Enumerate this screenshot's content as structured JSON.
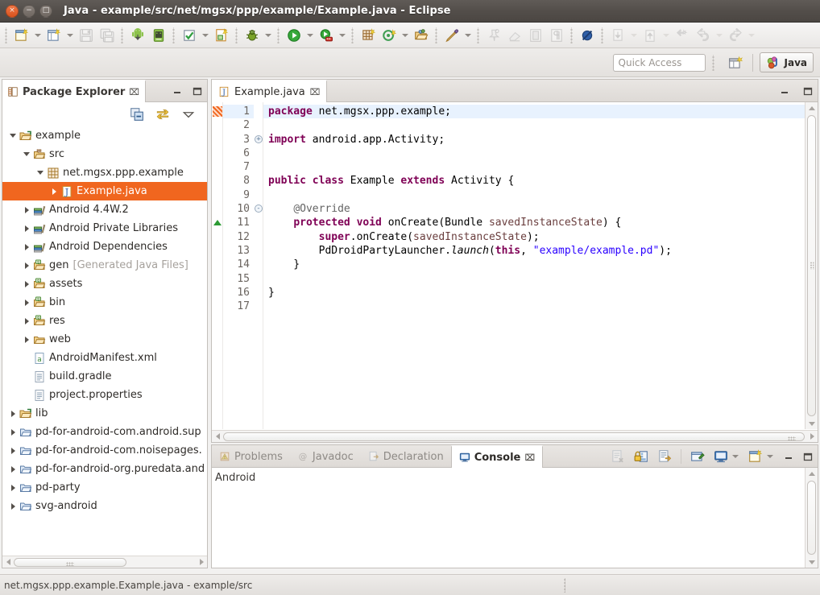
{
  "window": {
    "title": "Java - example/src/net/mgsx/ppp/example/Example.java - Eclipse",
    "buttons": {
      "close": "×",
      "minimize": "−",
      "maximize": "□"
    }
  },
  "toolbar": {
    "items": [
      {
        "name": "new-wizard",
        "tip": "New",
        "dropdown": true,
        "disabled": false
      },
      {
        "name": "new-java-project",
        "tip": "New Java Project",
        "dropdown": true,
        "disabled": false
      },
      {
        "name": "save",
        "tip": "Save",
        "dropdown": false,
        "disabled": true
      },
      {
        "name": "save-all",
        "tip": "Save All",
        "dropdown": false,
        "disabled": true
      },
      {
        "name": "android-sdk-manager",
        "tip": "Android SDK Manager",
        "dropdown": false,
        "disabled": false
      },
      {
        "name": "android-virtual-device-manager",
        "tip": "Android Virtual Device Manager",
        "dropdown": false,
        "disabled": false
      },
      {
        "name": "run-as-check",
        "tip": "Run",
        "dropdown": true,
        "disabled": false
      },
      {
        "name": "new-java-class",
        "tip": "New Java Class",
        "dropdown": false,
        "disabled": false
      },
      {
        "name": "debug-bug",
        "tip": "Debug",
        "dropdown": true,
        "disabled": false
      },
      {
        "name": "run-green",
        "tip": "Run",
        "dropdown": true,
        "disabled": false
      },
      {
        "name": "run-external-tools",
        "tip": "External Tools",
        "dropdown": true,
        "disabled": false
      },
      {
        "name": "new-package",
        "tip": "New Package",
        "dropdown": false,
        "disabled": false
      },
      {
        "name": "new-annotation",
        "tip": "New Annotation",
        "dropdown": true,
        "disabled": false
      },
      {
        "name": "open-type",
        "tip": "Open Type",
        "dropdown": false,
        "disabled": false
      },
      {
        "name": "search-marker",
        "tip": "Search",
        "dropdown": true,
        "disabled": false
      },
      {
        "name": "pin-editor",
        "tip": "Pin Editor",
        "dropdown": false,
        "disabled": true
      },
      {
        "name": "eraser",
        "tip": "Remove All",
        "dropdown": false,
        "disabled": true
      },
      {
        "name": "toggle-block-selection",
        "tip": "Toggle Block Selection",
        "dropdown": false,
        "disabled": true
      },
      {
        "name": "show-whitespace",
        "tip": "Show Whitespace Characters",
        "dropdown": false,
        "disabled": true
      },
      {
        "name": "skip-all-breakpoints",
        "tip": "Skip All Breakpoints",
        "dropdown": false,
        "disabled": false
      },
      {
        "name": "next-annotation",
        "tip": "Next Annotation",
        "dropdown": true,
        "disabled": true
      },
      {
        "name": "previous-annotation",
        "tip": "Previous Annotation",
        "dropdown": true,
        "disabled": true
      },
      {
        "name": "last-edit-location",
        "tip": "Last Edit Location",
        "dropdown": false,
        "disabled": true
      },
      {
        "name": "back",
        "tip": "Back",
        "dropdown": true,
        "disabled": true
      },
      {
        "name": "forward",
        "tip": "Forward",
        "dropdown": true,
        "disabled": true
      }
    ]
  },
  "quick_access": {
    "placeholder": "Quick Access",
    "value": "",
    "open_perspective_icon": "open-perspective-icon",
    "perspective_label": "Java"
  },
  "package_explorer": {
    "tab_label": "Package Explorer",
    "tab_icon": "package-explorer-icon",
    "close_glyph": "⌧",
    "minimize_glyph": "–",
    "maximize_glyph": "□",
    "view_tools": [
      {
        "name": "collapse-all-icon",
        "tip": "Collapse All"
      },
      {
        "name": "link-with-editor-icon",
        "tip": "Link with Editor"
      },
      {
        "name": "view-menu-icon",
        "tip": "View Menu"
      }
    ],
    "tree": [
      {
        "label": "example",
        "sub": "",
        "indent": 0,
        "twisty": "down",
        "icon": "project-folder-icon",
        "selected": false
      },
      {
        "label": "src",
        "sub": "",
        "indent": 1,
        "twisty": "down",
        "icon": "source-folder-icon",
        "selected": false
      },
      {
        "label": "net.mgsx.ppp.example",
        "sub": "",
        "indent": 2,
        "twisty": "down",
        "icon": "package-icon",
        "selected": false
      },
      {
        "label": "Example.java",
        "sub": "",
        "indent": 3,
        "twisty": "right",
        "icon": "java-file-icon",
        "selected": true
      },
      {
        "label": "Android 4.4W.2",
        "sub": "",
        "indent": 1,
        "twisty": "right",
        "icon": "library-icon",
        "selected": false
      },
      {
        "label": "Android Private Libraries",
        "sub": "",
        "indent": 1,
        "twisty": "right",
        "icon": "library-icon",
        "selected": false
      },
      {
        "label": "Android Dependencies",
        "sub": "",
        "indent": 1,
        "twisty": "right",
        "icon": "library-icon",
        "selected": false
      },
      {
        "label": "gen",
        "sub": "[Generated Java Files]",
        "indent": 1,
        "twisty": "right",
        "icon": "source-folder-gen-icon",
        "selected": false
      },
      {
        "label": "assets",
        "sub": "",
        "indent": 1,
        "twisty": "right",
        "icon": "source-folder-gen-icon",
        "selected": false
      },
      {
        "label": "bin",
        "sub": "",
        "indent": 1,
        "twisty": "right",
        "icon": "source-folder-gen-icon",
        "selected": false
      },
      {
        "label": "res",
        "sub": "",
        "indent": 1,
        "twisty": "right",
        "icon": "source-folder-gen-icon",
        "selected": false
      },
      {
        "label": "web",
        "sub": "",
        "indent": 1,
        "twisty": "right",
        "icon": "folder-icon",
        "selected": false
      },
      {
        "label": "AndroidManifest.xml",
        "sub": "",
        "indent": 1,
        "twisty": "none",
        "icon": "xml-file-icon",
        "selected": false
      },
      {
        "label": "build.gradle",
        "sub": "",
        "indent": 1,
        "twisty": "none",
        "icon": "text-file-icon",
        "selected": false
      },
      {
        "label": "project.properties",
        "sub": "",
        "indent": 1,
        "twisty": "none",
        "icon": "text-file-icon",
        "selected": false
      },
      {
        "label": "lib",
        "sub": "",
        "indent": 0,
        "twisty": "right",
        "icon": "project-folder-icon",
        "selected": false
      },
      {
        "label": "pd-for-android-com.android.sup",
        "sub": "",
        "indent": 0,
        "twisty": "right",
        "icon": "closed-project-icon",
        "selected": false
      },
      {
        "label": "pd-for-android-com.noisepages.",
        "sub": "",
        "indent": 0,
        "twisty": "right",
        "icon": "closed-project-icon",
        "selected": false
      },
      {
        "label": "pd-for-android-org.puredata.and",
        "sub": "",
        "indent": 0,
        "twisty": "right",
        "icon": "closed-project-icon",
        "selected": false
      },
      {
        "label": "pd-party",
        "sub": "",
        "indent": 0,
        "twisty": "right",
        "icon": "closed-project-icon",
        "selected": false
      },
      {
        "label": "svg-android",
        "sub": "",
        "indent": 0,
        "twisty": "right",
        "icon": "closed-project-icon",
        "selected": false
      }
    ]
  },
  "editor": {
    "tab_label": "Example.java",
    "tab_icon": "java-file-icon",
    "close_glyph": "⌧",
    "minimize_glyph": "–",
    "maximize_glyph": "□",
    "lines": [
      {
        "num": "1",
        "html": "<span class='kw'>package</span> net.mgsx.ppp.example;",
        "highlight": true,
        "fold": "",
        "marker": "hatch"
      },
      {
        "num": "2",
        "html": "",
        "highlight": false,
        "fold": "",
        "marker": ""
      },
      {
        "num": "3",
        "html": "<span class='kw'>import</span> android.app.Activity;",
        "highlight": false,
        "fold": "+",
        "marker": ""
      },
      {
        "num": "6",
        "html": "",
        "highlight": false,
        "fold": "",
        "marker": ""
      },
      {
        "num": "7",
        "html": "",
        "highlight": false,
        "fold": "",
        "marker": ""
      },
      {
        "num": "8",
        "html": "<span class='kw'>public class</span> Example <span class='kw'>extends</span> Activity {",
        "highlight": false,
        "fold": "",
        "marker": ""
      },
      {
        "num": "9",
        "html": "",
        "highlight": false,
        "fold": "",
        "marker": ""
      },
      {
        "num": "10",
        "html": "    <span class='ann'>@Override</span>",
        "highlight": false,
        "fold": "-",
        "marker": ""
      },
      {
        "num": "11",
        "html": "    <span class='kw'>protected void</span> onCreate(Bundle <span class='par'>savedInstanceState</span>) {",
        "highlight": false,
        "fold": "",
        "marker": "green-triangle"
      },
      {
        "num": "12",
        "html": "        <span class='kw'>super</span>.onCreate(<span class='par'>savedInstanceState</span>);",
        "highlight": false,
        "fold": "",
        "marker": ""
      },
      {
        "num": "13",
        "html": "        PdDroidPartyLauncher.<span class='ital'>launch</span>(<span class='kw'>this</span>, <span class='str'>\"example/example.pd\"</span>);",
        "highlight": false,
        "fold": "",
        "marker": ""
      },
      {
        "num": "14",
        "html": "    }",
        "highlight": false,
        "fold": "",
        "marker": ""
      },
      {
        "num": "15",
        "html": "",
        "highlight": false,
        "fold": "",
        "marker": ""
      },
      {
        "num": "16",
        "html": "}",
        "highlight": false,
        "fold": "",
        "marker": ""
      },
      {
        "num": "17",
        "html": "",
        "highlight": false,
        "fold": "",
        "marker": ""
      }
    ],
    "plain_source": "package net.mgsx.ppp.example;\n\nimport android.app.Activity;\n\n\npublic class Example extends Activity {\n\n    @Override\n    protected void onCreate(Bundle savedInstanceState) {\n        super.onCreate(savedInstanceState);\n        PdDroidPartyLauncher.launch(this, \"example/example.pd\");\n    }\n\n}"
  },
  "console_panel": {
    "tabs": [
      {
        "label": "Problems",
        "icon": "problems-icon",
        "active": false
      },
      {
        "label": "Javadoc",
        "icon": "javadoc-icon",
        "active": false
      },
      {
        "label": "Declaration",
        "icon": "declaration-icon",
        "active": false
      },
      {
        "label": "Console",
        "icon": "console-icon",
        "active": true
      }
    ],
    "close_glyph": "⌧",
    "minimize_glyph": "–",
    "maximize_glyph": "□",
    "tools": [
      {
        "name": "clear-console-icon",
        "tip": "Clear Console",
        "dropdown": false,
        "disabled": true
      },
      {
        "name": "scroll-lock-icon",
        "tip": "Scroll Lock",
        "dropdown": false,
        "disabled": false
      },
      {
        "name": "word-wrap-icon",
        "tip": "Word Wrap",
        "dropdown": false,
        "disabled": false
      },
      {
        "name": "pin-console-icon",
        "tip": "Pin Console",
        "dropdown": false,
        "disabled": false
      },
      {
        "name": "display-console-icon",
        "tip": "Display Selected Console",
        "dropdown": true,
        "disabled": false
      },
      {
        "name": "open-console-icon",
        "tip": "Open Console",
        "dropdown": true,
        "disabled": false
      }
    ],
    "content": "Android"
  },
  "status_bar": {
    "text": "net.mgsx.ppp.example.Example.java - example/src"
  }
}
